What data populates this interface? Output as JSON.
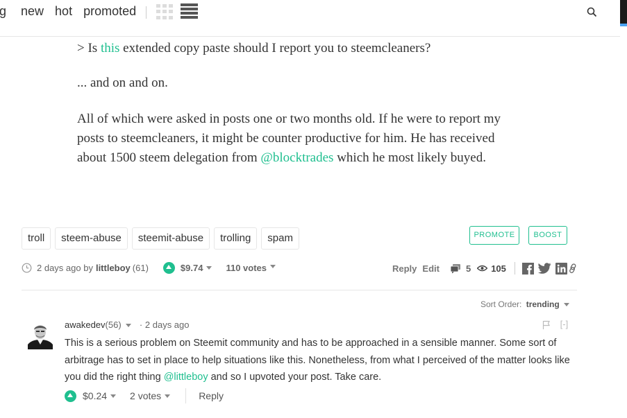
{
  "nav": {
    "items": [
      "g",
      "new",
      "hot",
      "promoted"
    ]
  },
  "post": {
    "para1_prefix": ">  Is ",
    "para1_link": "this",
    "para1_suffix": " extended copy paste should I report you to steemcleaners?",
    "para2": "... and on and on.",
    "para3_a": "All of which were asked in posts one or two months old. If he were to report my posts to steemcleaners, it might be counter productive for him. He has received about 1500 steem delegation from ",
    "para3_link": "@blocktrades",
    "para3_b": " which he most likely buyed.",
    "tags": [
      "troll",
      "steem-abuse",
      "steemit-abuse",
      "trolling",
      "spam"
    ],
    "promote_label": "PROMOTE",
    "boost_label": "BOOST",
    "time": "2 days ago by",
    "author": "littleboy",
    "rep": "(61)",
    "payout": "$9.74",
    "votes": "110 votes",
    "reply_label": "Reply",
    "edit_label": "Edit",
    "comment_count": "5",
    "view_count": "105"
  },
  "sort": {
    "label": "Sort Order:",
    "value": "trending"
  },
  "comment": {
    "author": "awakedev",
    "rep": "(56)",
    "time": "2 days ago",
    "collapse": "[-]",
    "text_a": "This is a serious problem on Steemit community and has to be approached in a sensible manner. Some sort of arbitrage has to set in place to help situations like this. Nonetheless, from what I perceived of the matter looks like you did the right thing ",
    "text_link": "@littleboy",
    "text_b": " and so I upvoted your post. Take care.",
    "payout": "$0.24",
    "votes": "2 votes",
    "reply_label": "Reply"
  },
  "colors": {
    "accent": "#1fbf8f"
  }
}
